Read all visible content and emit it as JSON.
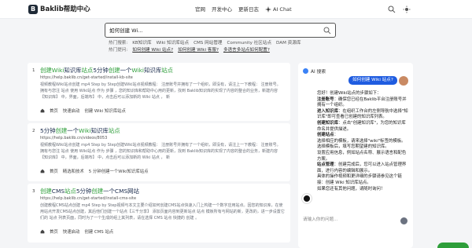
{
  "header": {
    "logo_letter": "B",
    "brand": "Baklib帮助中心",
    "nav": [
      "官网",
      "开发中心",
      "更新日志"
    ],
    "ai_chat": "AI Chat"
  },
  "search": {
    "value": "如何创建 Wi..."
  },
  "hot_searches": {
    "label": "热门搜索:",
    "tags": [
      "KB知识库",
      "Wiki 知识库站点",
      "CMS 网站管理",
      "Community 社区站点",
      "DAM 资源库"
    ]
  },
  "hot_questions": {
    "label": "热门提问:",
    "tags": [
      "如何创建 Wiki 站点?",
      "如何创建 Wiki 客服?",
      "多语言多站点如何配置?"
    ]
  },
  "results": [
    {
      "num": "1",
      "title_parts": [
        "创建",
        "Wiki",
        "知识库",
        "站点",
        "5分钟",
        "创建",
        "一个",
        "Wiki",
        "知识库",
        "站点"
      ],
      "url": "https://help.baklib.cn/get-started/install-kb-site",
      "snippet": "视频教程Wiki站点创建 mp4 Step by Step创建Wiki站点视频教程： 注册账号并拥有了一个组织，即没有，请注上一下教程： 注册账号。 拥有与您注 站点 使用 Wiki站点 作为 步骤 ，您的知识库和帮助中心用的更新，找到 Baklib知识库的实现了内容的整合的业务，新建内容 【知识库】 中，界面，后端布】 中，点击后可以添加新的 Wiki 站点 ， 新",
      "breadcrumb": [
        "首页",
        "快速启动",
        "创建 Wiki 知识库站点"
      ]
    },
    {
      "num": "2",
      "title_parts": [
        "5分钟",
        "创建",
        "一个",
        "Wiki",
        "知识库",
        "站点"
      ],
      "url": "https://help.baklib.cn/videos/8053",
      "snippet": "视频教程Wiki站点创建 mp4 Step by Step创建Wiki站点视频教程： 注册账号并拥有了一个组织，即没有，请注上一下教程： 注册账号。 拥有与您注 站点 使用 Wiki站点 作为 步骤 ，您的知识库和帮助中心用的更新，找到 Baklib知识库的实现了内容的整合的业务，新建内容 【知识库】 中，界面，后端布】 中，点击后可以添加新的 Wiki 站点 ， 新",
      "breadcrumb": [
        "首页",
        "精选和技术",
        "5 分钟创建一个Wiki知识库站点"
      ]
    },
    {
      "num": "3",
      "title_parts": [
        "创建",
        "CMS",
        "站点",
        "5分钟",
        "创建",
        "一个",
        "CMS",
        "网站"
      ],
      "url": "https://help.baklib.cn/get-started/install-cms-site",
      "snippet": "创建教程CMS站点创建 mp4 Step by Step视频与本文主要介绍如何创建CMS站点快速入门上构建一个数字应用站点。因您的知识库，在使用站点开发CMS站点创建，其后他们创建一个站点【三千分享】 添加页面内容到更新站点 站点 模板所有与网站的新，更改的，进一步设置它们的 站点 列表页面，同时为了一个生成的组上其列表，请在选择 CMS 站点 快捷的 创建 。",
      "breadcrumb": [
        "首页",
        "快速启动",
        "创建 CMS 站点"
      ]
    }
  ],
  "ai": {
    "header": "AI 搜索",
    "question": "如何创建 Wiki 站点?",
    "answer": [
      {
        "k": "",
        "v": "您好！创建Wiki站点的步骤如下："
      },
      {
        "k": "注册账号",
        "v": "：确保您已经在Baklib平台注册账号并拥有一个组织。"
      },
      {
        "k": "进入知识库",
        "v": "：在组织工作台的左侧导航中选择\"知识库\"即可查看已创建的知识库列表。"
      },
      {
        "k": "创建知识库",
        "v": "：点击\"创建知识库\"，为您的知识库命名并提供描述。"
      },
      {
        "k": "创建站点",
        "v": "："
      },
      {
        "k": "",
        "v": "选择相应的模板，请来选择\"wiki\"标签的模板。"
      },
      {
        "k": "",
        "v": "选择模板后，填写您期望建的知识库。"
      },
      {
        "k": "",
        "v": "设置应用信息，例如站点名称、展示语言和配色方案。"
      },
      {
        "k": "站点管理",
        "v": "：创建完成后，您可以进入站点管理界面，进行内容的编辑和展示。"
      },
      {
        "k": "",
        "v": "具体的操作视频和更详细的步骤请参见这个链接：创建 Wiki 知识库站点。"
      },
      {
        "k": "",
        "v": "如果您还有其他问题，请随时询问！"
      }
    ],
    "link_text": "创建 Wiki 知识库站点",
    "input_placeholder": "请输入你的问题..."
  },
  "colors": {
    "highlight": "#2e9e3a",
    "primary": "#1f5ce0",
    "background": "#f4f5f7"
  }
}
